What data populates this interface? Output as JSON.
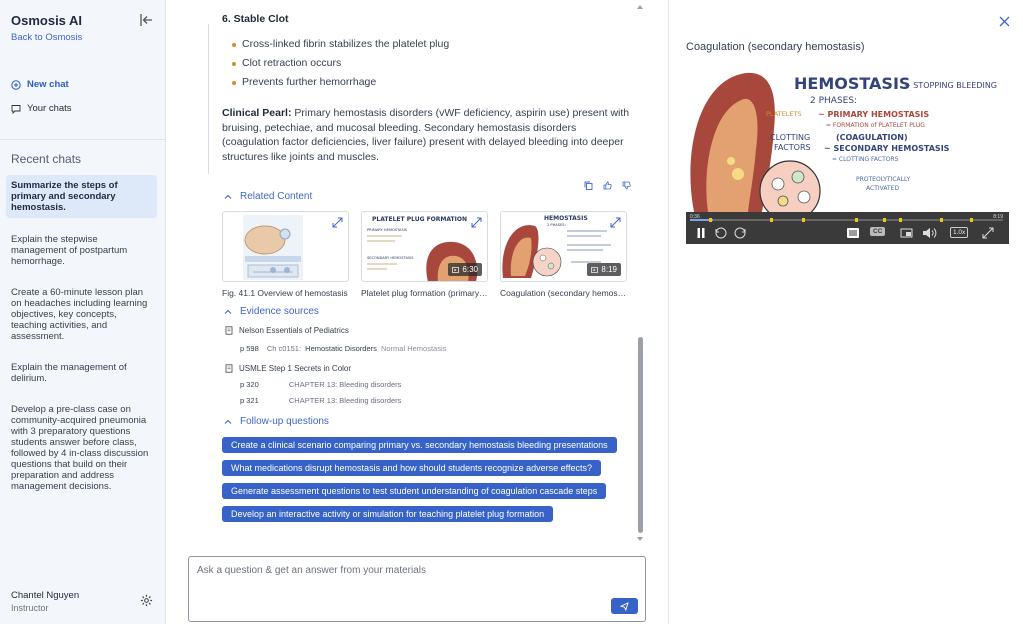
{
  "sidebar": {
    "brand": "Osmosis AI",
    "back_link": "Back to Osmosis",
    "new_chat": "New chat",
    "your_chats": "Your chats",
    "recent_title": "Recent chats",
    "chats": [
      "Summarize the steps of primary and secondary hemostasis.",
      "Explain the stepwise management of postpartum hemorrhage.",
      "Create a 60-minute lesson plan on headaches including learning objectives, key concepts, teaching activities, and assessment.",
      "Explain the management of delirium.",
      "Develop a pre-class case on community-acquired pneumonia with 3 preparatory questions students answer before class, followed by 4 in-class discussion questions that build on their preparation and address management decisions."
    ],
    "user_name": "Chantel Nguyen",
    "user_role": "Instructor"
  },
  "main": {
    "step_title": "6. Stable Clot",
    "bullets": [
      "Cross-linked fibrin stabilizes the platelet plug",
      "Clot retraction occurs",
      "Prevents further hemorrhage"
    ],
    "pearl_label": "Clinical Pearl:",
    "pearl_text": " Primary hemostasis disorders (vWF deficiency, aspirin use) present with bruising, petechiae, and mucosal bleeding. Secondary hemostasis disorders (coagulation factor deficiencies, liver failure) present with delayed bleeding into deeper structures like joints and muscles.",
    "related_title": "Related Content",
    "cards": [
      {
        "caption": "Fig. 41.1 Overview of hemostasis",
        "duration": ""
      },
      {
        "caption": "Platelet plug formation (primary hemostasis)",
        "duration": "6:30"
      },
      {
        "caption": "Coagulation (secondary hemostasis)",
        "duration": "8:19"
      }
    ],
    "thumb_text": {
      "platelet_title": "PLATELET PLUG FORMATION",
      "platelet_sub1": "PRIMARY HEMOSTASIS",
      "platelet_sub2": "SECONDARY HEMOSTASIS",
      "coag_title": "HEMOSTASIS",
      "coag_sub": "2 PHASES:"
    },
    "evidence_title": "Evidence sources",
    "sources": [
      {
        "book": "Nelson Essentials of Pediatrics",
        "rows": [
          {
            "page": "p 598",
            "chapter": "Ch c0151:",
            "title": "Hemostatic Disorders",
            "sub": "Normal Hemostasis"
          }
        ]
      },
      {
        "book": "USMLE Step 1 Secrets in Color",
        "rows": [
          {
            "page": "p 320",
            "chapter": "CHAPTER 13: Bleeding disorders"
          },
          {
            "page": "p 321",
            "chapter": "CHAPTER 13: Bleeding disorders"
          }
        ]
      }
    ],
    "followup_title": "Follow-up questions",
    "followups": [
      "Create a clinical scenario comparing primary vs. secondary hemostasis bleeding presentations",
      "What medications disrupt hemostasis and how should students recognize adverse effects?",
      "Generate assessment questions to test student understanding of coagulation cascade steps",
      "Develop an interactive activity or simulation for teaching platelet plug formation"
    ],
    "composer_placeholder": "Ask a question & get an answer from your materials"
  },
  "video": {
    "title": "Coagulation (secondary hemostasis)",
    "time_start": "0:36",
    "time_end": "8:19",
    "progress": 0.072,
    "speed": "1.0x",
    "cc": "CC",
    "board": {
      "heading": "HEMOSTASIS",
      "heading_tail": "~ STOPPING BLEEDING",
      "phases": "2 PHASES:",
      "primary": "~ PRIMARY HEMOSTASIS",
      "formation": "= FORMATION of PLATELET PLUG",
      "coagulation": "(COAGULATION)",
      "secondary": "~ SECONDARY HEMOSTASIS",
      "clotting": "= CLOTTING FACTORS",
      "proteolytic": "PROTEOLYTICALLY",
      "activated": "ACTIVATED",
      "platelets": "PLATELETS",
      "clotting_label": "CLOTTING",
      "factors_label": "FACTORS"
    }
  },
  "colors": {
    "accent": "#3763c8",
    "sidebar_bg": "#f3f6fb",
    "active_chat": "#dde8f8",
    "bullet": "#d98a2b"
  }
}
